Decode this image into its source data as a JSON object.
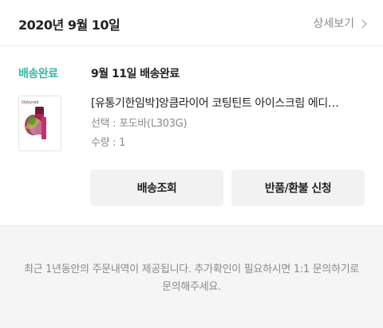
{
  "order": {
    "date": "2020년 9월 10일",
    "detail_link": "상세보기"
  },
  "delivery": {
    "status_label": "배송완료",
    "status_text": "9월 11일 배송완료"
  },
  "product": {
    "name": "[유통기한임박]앙큼라이어 코팅틴트 아이스크림 에디…",
    "option": "선택 : 포도바(L303G)",
    "quantity": "수량 : 1",
    "thumbnail_brand": "lilybyred"
  },
  "buttons": {
    "track": "배송조회",
    "return": "반품/환불 신청"
  },
  "footer": {
    "notice": "최근 1년동안의 주문내역이 제공됩니다. 추가확인이 필요하시면 1:1 문의하기로 문의해주세요."
  },
  "colors": {
    "status_accent": "#35b8a4",
    "button_bg": "#f2f2f2",
    "footer_bg": "#f5f5f5"
  }
}
